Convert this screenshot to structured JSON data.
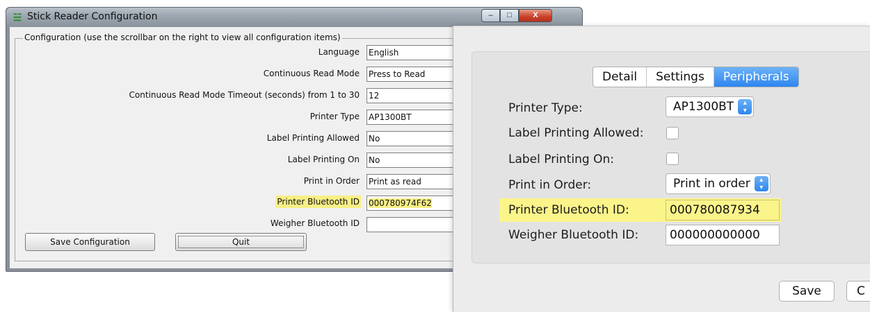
{
  "windows_dialog": {
    "title": "Stick Reader Configuration",
    "title_icon": "app-icon",
    "controls": {
      "minimize": "–",
      "maximize": "□",
      "close": "X"
    },
    "group_label": "Configuration (use the scrollbar on the right to view all configuration items)",
    "rows": [
      {
        "label": "Language",
        "value": "English"
      },
      {
        "label": "Continuous Read Mode",
        "value": "Press to Read"
      },
      {
        "label": "Continuous Read Mode Timeout (seconds) from 1 to 30",
        "value": "12"
      },
      {
        "label": "Printer Type",
        "value": "AP1300BT"
      },
      {
        "label": "Label Printing Allowed",
        "value": "No"
      },
      {
        "label": "Label Printing On",
        "value": "No"
      },
      {
        "label": "Print in Order",
        "value": "Print as read"
      },
      {
        "label": "Printer Bluetooth ID",
        "value": "000780974F62"
      },
      {
        "label": "Weigher Bluetooth ID",
        "value": ""
      }
    ],
    "buttons": {
      "save": "Save Configuration",
      "quit": "Quit"
    }
  },
  "mac_sheet": {
    "tabs": [
      {
        "label": "Detail",
        "active": false
      },
      {
        "label": "Settings",
        "active": false
      },
      {
        "label": "Peripherals",
        "active": true
      }
    ],
    "fields": {
      "printer_type": {
        "label": "Printer Type:",
        "value": "AP1300BT"
      },
      "label_printing_allowed": {
        "label": "Label Printing Allowed:",
        "checked": false
      },
      "label_printing_on": {
        "label": "Label Printing On:",
        "checked": false
      },
      "print_in_order": {
        "label": "Print in Order:",
        "value": "Print in order"
      },
      "printer_bluetooth_id": {
        "label": "Printer Bluetooth ID:",
        "value": "000780087934"
      },
      "weigher_bluetooth_id": {
        "label": "Weigher Bluetooth ID:",
        "value": "000000000000"
      }
    },
    "buttons": {
      "save": "Save",
      "cancel_partial": "C"
    }
  },
  "colors": {
    "highlight": "#fbf48a",
    "mac_accent": "#2f86ef",
    "close_red": "#c7402a"
  }
}
